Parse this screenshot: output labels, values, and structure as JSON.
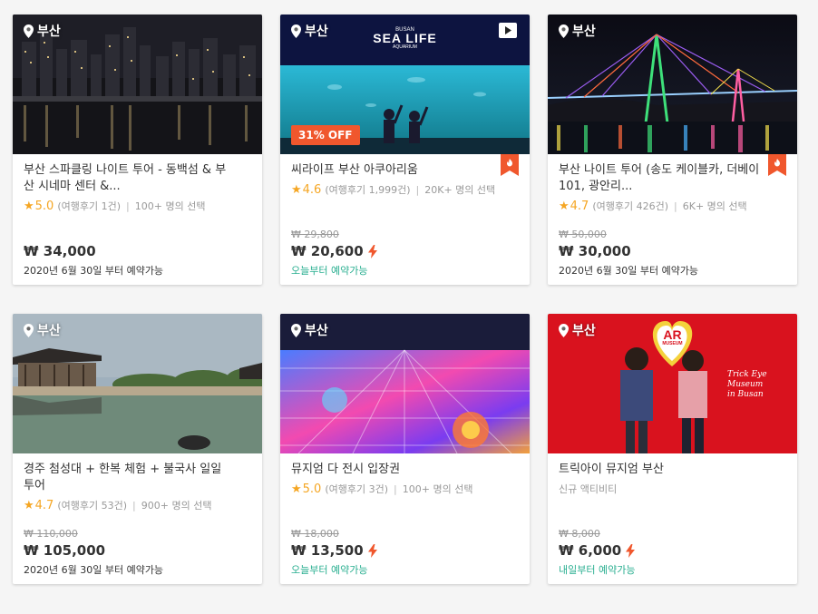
{
  "currency_symbol": "₩",
  "colors": {
    "discount": "#f0572d",
    "star": "#f5a623",
    "instant": "#27ae8f",
    "bolt": "#f0572d"
  },
  "cards": [
    {
      "location": "부산",
      "title": "부산 스파클링 나이트 투어 - 동백섬 & 부산 시네마 센터 &...",
      "rating": "5.0",
      "reviews": "(여행후기 1건)",
      "bookings": "100+ 명의 선택",
      "original_price": "",
      "price": "₩ 34,000",
      "availability": "2020년 6월 30일 부터 예약가능",
      "image": "night-city-skyline"
    },
    {
      "location": "부산",
      "title": "씨라이프 부산 아쿠아리움",
      "rating": "4.6",
      "reviews": "(여행후기 1,999건)",
      "bookings": "20K+ 명의 선택",
      "original_price": "₩ 29,800",
      "price": "₩ 20,600",
      "availability": "오늘부터 예약가능",
      "discount": "31% OFF",
      "sign": "SEA LIFE",
      "sign_top": "BUSAN",
      "sign_bottom": "AQUARIUM",
      "image": "aquarium"
    },
    {
      "location": "부산",
      "title": "부산 나이트 투어 (송도 케이블카, 더베이 101, 광안리...",
      "rating": "4.7",
      "reviews": "(여행후기 426건)",
      "bookings": "6K+ 명의 선택",
      "original_price": "₩ 50,000",
      "price": "₩ 30,000",
      "availability": "2020년 6월 30일 부터 예약가능",
      "image": "bridge-night"
    },
    {
      "location": "부산",
      "title": "경주 첨성대 + 한복 체험 + 불국사 일일 투어",
      "rating": "4.7",
      "reviews": "(여행후기 53건)",
      "bookings": "900+ 명의 선택",
      "original_price": "₩ 110,000",
      "price": "₩ 105,000",
      "availability": "2020년 6월 30일 부터 예약가능",
      "image": "pavilion-lake"
    },
    {
      "location": "부산",
      "title": "뮤지엄 다 전시 입장권",
      "rating": "5.0",
      "reviews": "(여행후기 3건)",
      "bookings": "100+ 명의 선택",
      "original_price": "₩ 18,000",
      "price": "₩ 13,500",
      "availability": "오늘부터 예약가능",
      "image": "digital-art-museum"
    },
    {
      "location": "부산",
      "title": "트릭아이 뮤지엄 부산",
      "new_label": "신규 액티비티",
      "original_price": "₩ 8,000",
      "price": "₩ 6,000",
      "availability": "내일부터 예약가능",
      "sign_ar": "AR",
      "sign_museum": "MUSEUM",
      "script_text": "Trick Eye Museum",
      "script_sub": "in Busan",
      "image": "trick-eye-museum"
    }
  ]
}
